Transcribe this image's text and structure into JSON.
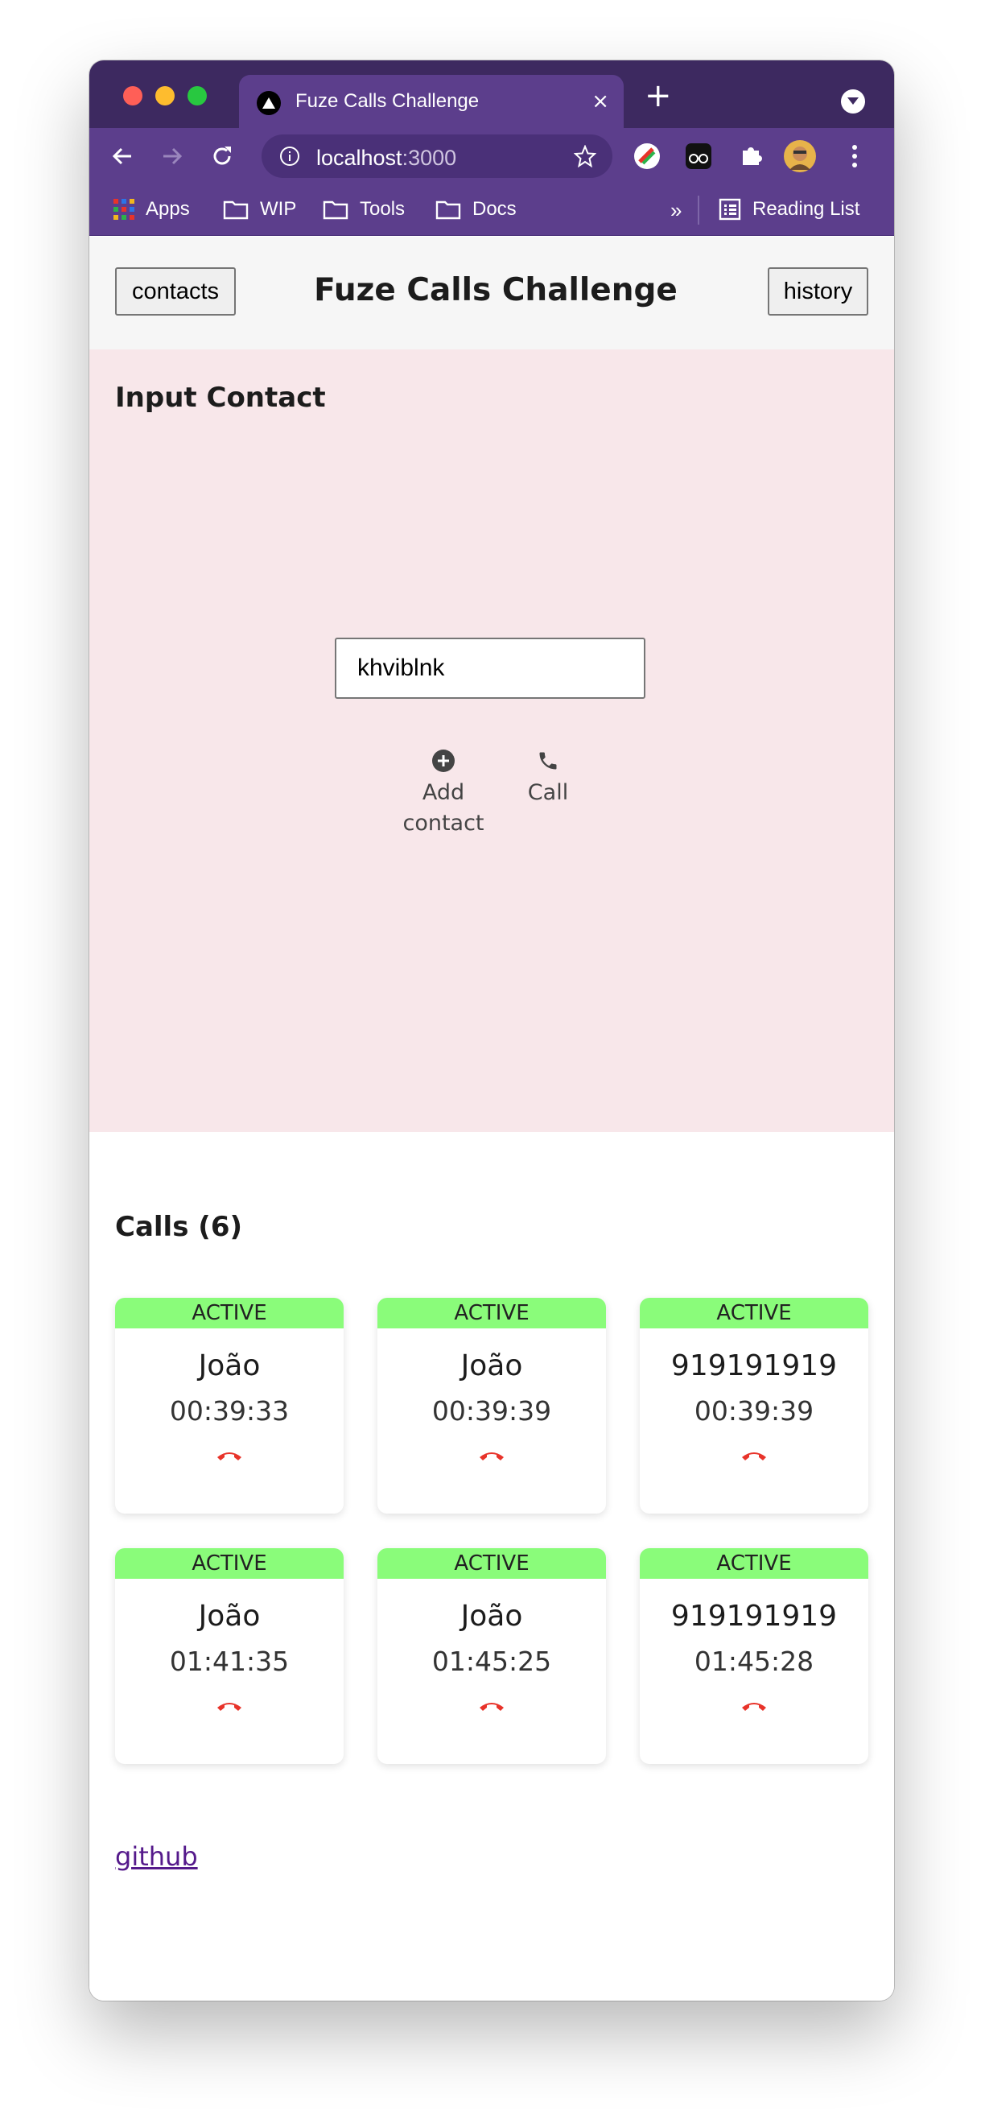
{
  "browser": {
    "tab_title": "Fuze Calls Challenge",
    "tab_close": "×",
    "new_tab": "+",
    "url_host": "localhost",
    "url_port": ":3000",
    "bookmarks": [
      "Apps",
      "WIP",
      "Tools",
      "Docs"
    ],
    "overflow": "»",
    "reading_list": "Reading List"
  },
  "header": {
    "contacts_button": "contacts",
    "title": "Fuze Calls Challenge",
    "history_button": "history"
  },
  "input_section": {
    "title": "Input Contact",
    "input_value": "khviblnk",
    "add_contact_line1": "Add",
    "add_contact_line2": "contact",
    "call_label": "Call"
  },
  "calls": {
    "title": "Calls (6)",
    "items": [
      {
        "status": "ACTIVE",
        "name": "João",
        "duration": "00:39:33"
      },
      {
        "status": "ACTIVE",
        "name": "João",
        "duration": "00:39:39"
      },
      {
        "status": "ACTIVE",
        "name": "919191919",
        "duration": "00:39:39"
      },
      {
        "status": "ACTIVE",
        "name": "João",
        "duration": "01:41:35"
      },
      {
        "status": "ACTIVE",
        "name": "João",
        "duration": "01:45:25"
      },
      {
        "status": "ACTIVE",
        "name": "919191919",
        "duration": "01:45:28"
      }
    ]
  },
  "footer": {
    "link": "github"
  },
  "colors": {
    "chrome": "#5c3e8c",
    "input_bg": "#f8e7ea",
    "active_badge": "#8afc7a",
    "hangup": "#e8332a",
    "link": "#551a8b"
  }
}
